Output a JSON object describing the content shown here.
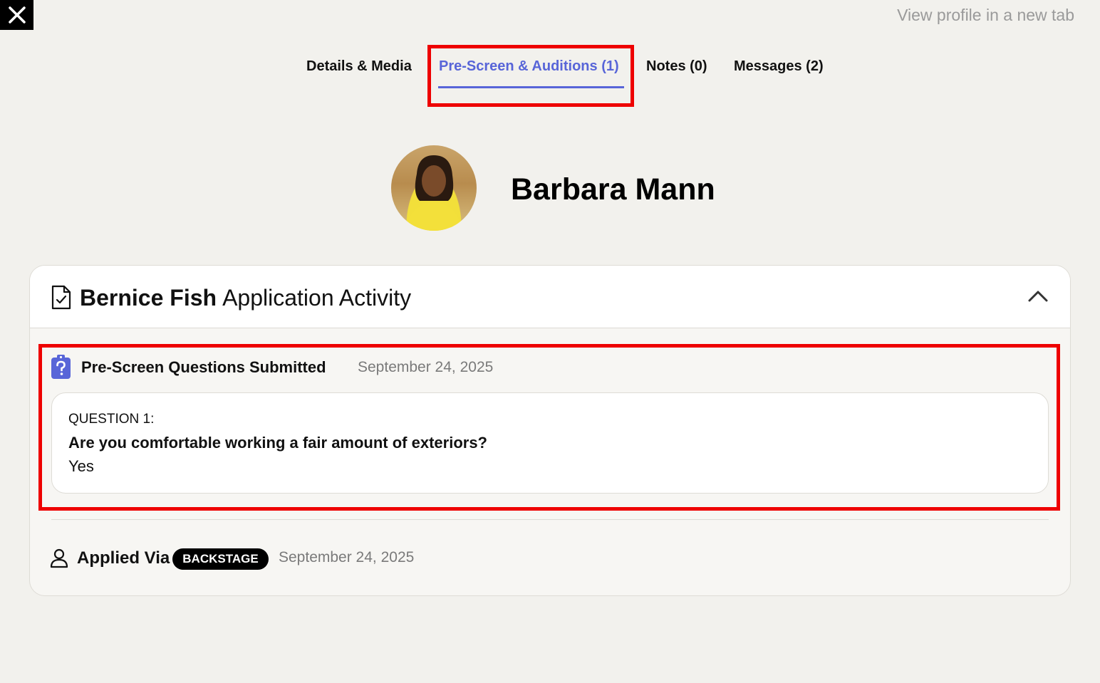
{
  "header": {
    "close_icon": "close-icon",
    "view_profile_link": "View profile in a new tab"
  },
  "tabs": [
    {
      "label": "Details & Media",
      "active": false
    },
    {
      "label": "Pre-Screen & Auditions (1)",
      "active": true
    },
    {
      "label": "Notes (0)",
      "active": false
    },
    {
      "label": "Messages (2)",
      "active": false
    }
  ],
  "profile": {
    "name": "Barbara Mann"
  },
  "activity_card": {
    "icon": "document-check-icon",
    "name": "Bernice Fish",
    "title": "Application Activity",
    "collapse_icon": "chevron-up-icon"
  },
  "prescreen": {
    "icon": "clipboard-question-icon",
    "title": "Pre-Screen Questions Submitted",
    "date": "September 24, 2025",
    "question_label": "QUESTION 1:",
    "question": "Are you comfortable working a fair amount of exteriors?",
    "answer": "Yes"
  },
  "applied": {
    "icon": "person-icon",
    "label": "Applied Via",
    "badge": "BACKSTAGE",
    "date": "September 24, 2025"
  },
  "colors": {
    "accent": "#5865d8",
    "highlight": "#ee0000",
    "background": "#f2f1ed"
  }
}
